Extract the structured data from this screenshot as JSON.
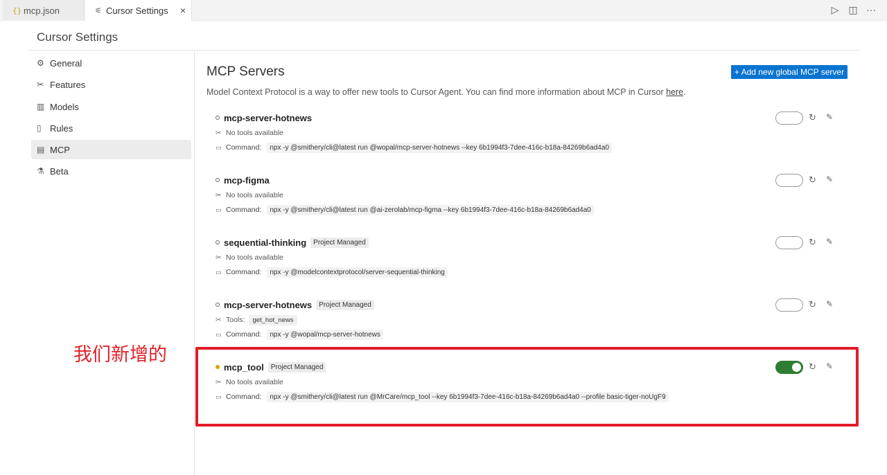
{
  "tabs": [
    {
      "icon": "json-icon",
      "label": "mcp.json"
    },
    {
      "icon": "settings-sliders-icon",
      "label": "Cursor Settings",
      "close": "×"
    }
  ],
  "top_actions": [
    {
      "icon": "run-icon",
      "glyph": "▷"
    },
    {
      "icon": "split-editor-icon",
      "glyph": "◫"
    },
    {
      "icon": "more-icon",
      "glyph": "···"
    }
  ],
  "settings_title": "Cursor Settings",
  "sidebar": {
    "items": [
      {
        "icon": "gear-icon",
        "glyph": "⚙",
        "label": "General"
      },
      {
        "icon": "tools-icon",
        "glyph": "✂",
        "label": "Features"
      },
      {
        "icon": "chart-icon",
        "glyph": "▥",
        "label": "Models"
      },
      {
        "icon": "book-icon",
        "glyph": "▯",
        "label": "Rules"
      },
      {
        "icon": "server-icon",
        "glyph": "▤",
        "label": "MCP"
      },
      {
        "icon": "flask-icon",
        "glyph": "⚗",
        "label": "Beta"
      }
    ],
    "active": "MCP"
  },
  "main": {
    "title": "MCP Servers",
    "add_button": "+ Add new global MCP server",
    "description": "Model Context Protocol is a way to offer new tools to Cursor Agent. You can find more information about MCP in Cursor ",
    "description_link": "here",
    "description_end": "."
  },
  "servers": [
    {
      "name": "mcp-server-hotnews",
      "badge": "",
      "status": "off",
      "tools_label": "No tools available",
      "tools": [],
      "command_label": "Command:",
      "command": "npx -y @smithery/cli@latest run @wopal/mcp-server-hotnews --key 6b1994f3-7dee-416c-b18a-84269b6ad4a0",
      "enabled": false
    },
    {
      "name": "mcp-figma",
      "badge": "",
      "status": "off",
      "tools_label": "No tools available",
      "tools": [],
      "command_label": "Command:",
      "command": "npx -y @smithery/cli@latest run @ai-zerolab/mcp-figma --key 6b1994f3-7dee-416c-b18a-84269b6ad4a0",
      "enabled": false
    },
    {
      "name": "sequential-thinking",
      "badge": "Project Managed",
      "status": "off",
      "tools_label": "No tools available",
      "tools": [],
      "command_label": "Command:",
      "command": "npx -y @modelcontextprotocol/server-sequential-thinking",
      "enabled": false
    },
    {
      "name": "mcp-server-hotnews",
      "badge": "Project Managed",
      "status": "off",
      "tools_label": "Tools:",
      "tools": [
        "get_hot_news"
      ],
      "command_label": "Command:",
      "command": "npx -y @wopal/mcp-server-hotnews",
      "enabled": false
    },
    {
      "name": "mcp_tool",
      "badge": "Project Managed",
      "status": "pending",
      "tools_label": "No tools available",
      "tools": [],
      "command_label": "Command:",
      "command": "npx -y @smithery/cli@latest run @MrCare/mcp_tool --key 6b1994f3-7dee-416c-b18a-84269b6ad4a0 --profile basic-tiger-noUgF9",
      "enabled": true
    }
  ],
  "annotation": {
    "text": "我们新增的",
    "color": "#e21c2a"
  },
  "colors": {
    "accent": "#0a74d1",
    "toggle_on": "#2e7d32",
    "pending_dot": "#d9a400"
  }
}
